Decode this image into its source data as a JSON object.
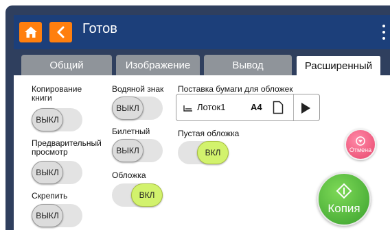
{
  "header": {
    "title": "Готов"
  },
  "tabs": [
    {
      "label": "Общий"
    },
    {
      "label": "Изображение"
    },
    {
      "label": "Вывод"
    },
    {
      "label": "Расширенный"
    }
  ],
  "active_tab": "Расширенный",
  "settings": {
    "book_copy": {
      "label": "Копирование книги",
      "state": "ВЫКЛ"
    },
    "preview": {
      "label": "Предварительный просмотр",
      "state": "ВЫКЛ"
    },
    "staple": {
      "label": "Скрепить",
      "state": "ВЫКЛ"
    },
    "watermark": {
      "label": "Водяной знак",
      "state": "ВЫКЛ"
    },
    "ticket": {
      "label": "Билетный",
      "state": "ВЫКЛ"
    },
    "cover": {
      "label": "Обложка",
      "state": "ВКЛ"
    },
    "cover_feed": {
      "label": "Поставка бумаги для обложек",
      "tray": "Лоток1",
      "size": "A4"
    },
    "blank_cover": {
      "label": "Пустая обложка",
      "state": "ВКЛ"
    }
  },
  "actions": {
    "cancel_label": "Отмена",
    "copy_label": "Копия"
  },
  "colors": {
    "accent_orange": "#ff7f0e",
    "header_blue": "#1c3f7a",
    "toggle_on": "#d2f26d",
    "cancel_pink": "#e8466c",
    "copy_green": "#3aa12e"
  }
}
